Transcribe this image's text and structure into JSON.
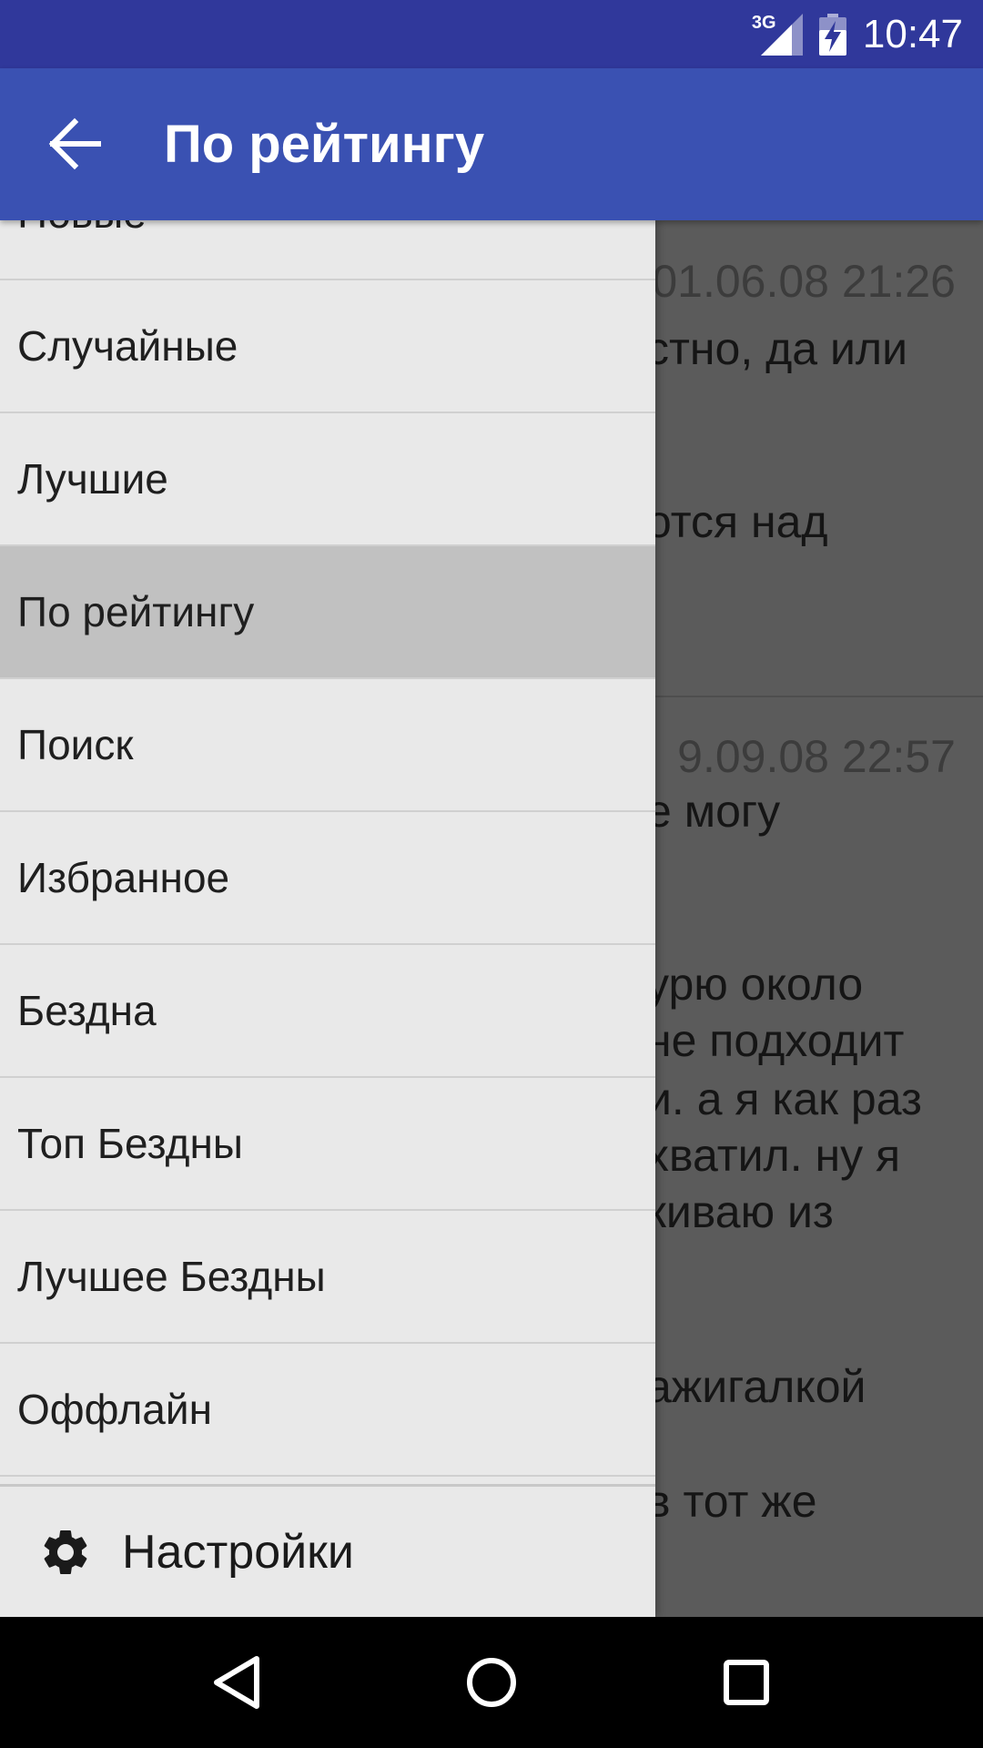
{
  "status_bar": {
    "network": "3G",
    "time": "10:47"
  },
  "app_bar": {
    "title": "По рейтингу"
  },
  "drawer": {
    "items": [
      {
        "label": "Новые",
        "selected": false
      },
      {
        "label": "Случайные",
        "selected": false
      },
      {
        "label": "Лучшие",
        "selected": false
      },
      {
        "label": "По рейтингу",
        "selected": true
      },
      {
        "label": "Поиск",
        "selected": false
      },
      {
        "label": "Избранное",
        "selected": false
      },
      {
        "label": "Бездна",
        "selected": false
      },
      {
        "label": "Топ Бездны",
        "selected": false
      },
      {
        "label": "Лучшее Бездны",
        "selected": false
      },
      {
        "label": "Оффлайн",
        "selected": false
      }
    ],
    "footer": {
      "settings_label": "Настройки",
      "icon": "gear-icon"
    }
  },
  "content": {
    "posts": [
      {
        "date_visible": "01.06.08 21:26",
        "lines_visible": [
          "стно, да или",
          "отся над"
        ]
      },
      {
        "date_visible": "9.09.08 22:57",
        "lines_visible": [
          "е могу",
          "урю около",
          "не подходит",
          "и. а я как раз",
          "хватил. ну я",
          "киваю из",
          "ажигалкой",
          "в тот же"
        ]
      }
    ]
  },
  "nav_bar": {
    "back_icon": "triangle-back-icon",
    "home_icon": "circle-home-icon",
    "recents_icon": "square-recents-icon"
  },
  "colors": {
    "status_bar": "#30389b",
    "app_bar": "#3a51b2",
    "drawer_bg": "#e9e9e9",
    "selected_item": "#c1c1c1",
    "scrim": "#5b5b5b"
  }
}
